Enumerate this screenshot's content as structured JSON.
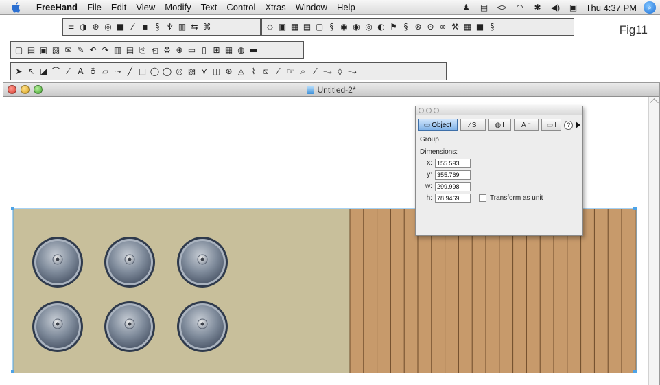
{
  "menubar": {
    "app_name": "FreeHand",
    "items": [
      "File",
      "Edit",
      "View",
      "Modify",
      "Text",
      "Control",
      "Xtras",
      "Window",
      "Help"
    ],
    "clock": "Thu 4:37 PM",
    "status_icons": [
      "user-icon",
      "clipboard-icon",
      "code-icon",
      "wifi-icon",
      "bluetooth-icon",
      "volume-icon",
      "display-icon",
      "spotlight-icon"
    ]
  },
  "figure_label": "Fig11",
  "toolbars": {
    "xtras_operations": [
      "≡",
      "◑",
      "⊛",
      "◎",
      "■",
      "⁄",
      "▪",
      "§",
      "♆",
      "▥",
      "⇆",
      "⌘"
    ],
    "xtras_tools": [
      "◇",
      "▣",
      "▦",
      "▤",
      "▢",
      "§",
      "◉",
      "◉",
      "◎",
      "◐",
      "⚑",
      "§",
      "⊗",
      "⊙",
      "∞",
      "⚒",
      "▦",
      "■",
      "§"
    ],
    "main": [
      "▢",
      "▤",
      "▣",
      "▨",
      "✉",
      "✎",
      "↶",
      "↷",
      "▥",
      "▤",
      "⎘",
      "⎗",
      "⚙",
      "⊕",
      "▭",
      "▯",
      "⊞",
      "▦",
      "◍",
      "▬"
    ],
    "tools": [
      "➤",
      "↖",
      "◪",
      "⌒",
      "⁄",
      "A",
      "♁",
      "▱",
      "⤳",
      "╱",
      "□",
      "◯",
      "◯",
      "◎",
      "▧",
      "⋎",
      "◫",
      "⊛",
      "◬",
      "⌇",
      "⧅",
      "⁄",
      "☞",
      "⌕",
      "⁄",
      "⤍",
      "◊",
      "⤍"
    ]
  },
  "document": {
    "title": "Untitled-2*"
  },
  "inspector": {
    "tabs": [
      {
        "icon": "▭",
        "label": "Object"
      },
      {
        "icon": "⁄",
        "label": "S"
      },
      {
        "icon": "◍",
        "label": "I"
      },
      {
        "icon": "A",
        "label": "⁻"
      },
      {
        "icon": "▭",
        "label": "I"
      }
    ],
    "help": "?",
    "object_type": "Group",
    "section": "Dimensions:",
    "fields": {
      "x": {
        "label": "x:",
        "value": "155.593"
      },
      "y": {
        "label": "y:",
        "value": "355.769"
      },
      "w": {
        "label": "w:",
        "value": "299.998"
      },
      "h": {
        "label": "h:",
        "value": "78.9469"
      }
    },
    "transform_label": "Transform as unit"
  },
  "colors": {
    "khaki_panel": "#c8bf9b",
    "wood": "#c79a6b",
    "wood_line": "#6d4b2a",
    "speaker_ring": "#3c4a62",
    "speaker_face": "#8a96a5",
    "selection": "#4ea3e6"
  }
}
